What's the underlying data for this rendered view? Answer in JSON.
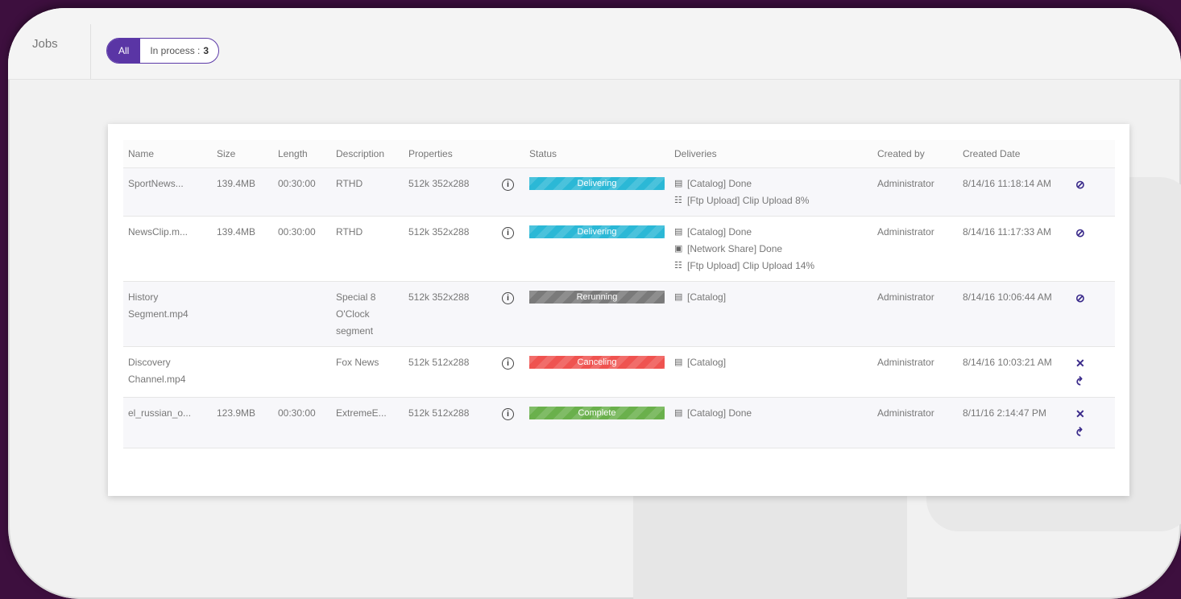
{
  "topbar": {
    "jobs_tab": "Jobs",
    "filter_all": "All",
    "filter_inprocess_label": "In process :",
    "filter_inprocess_count": "3"
  },
  "table": {
    "headers": [
      "Name",
      "Size",
      "Length",
      "Description",
      "Properties",
      "Status",
      "Deliveries",
      "Created by",
      "Created Date"
    ],
    "rows": [
      {
        "name": "SportNews...",
        "size": "139.4MB",
        "length": "00:30:00",
        "description": "RTHD",
        "properties": "512k 352x288",
        "status": "Delivering",
        "status_color": "#2bb8d6",
        "deliveries": [
          {
            "icon": "catalog-icon",
            "text": "[Catalog] Done"
          },
          {
            "icon": "ftp-icon",
            "text": "[Ftp Upload] Clip Upload 8%"
          }
        ],
        "created_by": "Administrator",
        "created_date": "8/14/16 11:18:14 AM",
        "actions": [
          "cancel-circle-icon"
        ]
      },
      {
        "name": "NewsClip.m...",
        "size": "139.4MB",
        "length": "00:30:00",
        "description": "RTHD",
        "properties": "512k 352x288",
        "status": "Delivering",
        "status_color": "#2bb8d6",
        "deliveries": [
          {
            "icon": "catalog-icon",
            "text": "[Catalog] Done"
          },
          {
            "icon": "network-share-icon",
            "text": "[Network Share] Done"
          },
          {
            "icon": "ftp-icon",
            "text": "[Ftp Upload] Clip Upload 14%"
          }
        ],
        "created_by": "Administrator",
        "created_date": "8/14/16 11:17:33 AM",
        "actions": [
          "cancel-circle-icon"
        ]
      },
      {
        "name": "History Segment.mp4",
        "size": "",
        "length": "",
        "description": "Special 8 O'Clock segment",
        "properties": "512k 352x288",
        "status": "Rerunning",
        "status_color": "#7a7a7a",
        "deliveries": [
          {
            "icon": "catalog-icon",
            "text": "[Catalog]"
          }
        ],
        "created_by": "Administrator",
        "created_date": "8/14/16 10:06:44 AM",
        "actions": [
          "cancel-circle-icon"
        ]
      },
      {
        "name": "Discovery Channel.mp4",
        "size": "",
        "length": "",
        "description": "Fox News",
        "properties": "512k 512x288",
        "status": "Canceling",
        "status_color": "#ef5350",
        "deliveries": [
          {
            "icon": "catalog-icon",
            "text": "[Catalog]"
          }
        ],
        "created_by": "Administrator",
        "created_date": "8/14/16 10:03:21 AM",
        "actions": [
          "close-icon",
          "undo-icon"
        ]
      },
      {
        "name": "el_russian_o...",
        "size": "123.9MB",
        "length": "00:30:00",
        "description": "ExtremeE...",
        "properties": "512k 512x288",
        "status": "Complete",
        "status_color": "#6ab04c",
        "deliveries": [
          {
            "icon": "catalog-icon",
            "text": "[Catalog] Done"
          }
        ],
        "created_by": "Administrator",
        "created_date": "8/11/16 2:14:47 PM",
        "actions": [
          "close-icon",
          "undo-icon"
        ]
      }
    ]
  }
}
